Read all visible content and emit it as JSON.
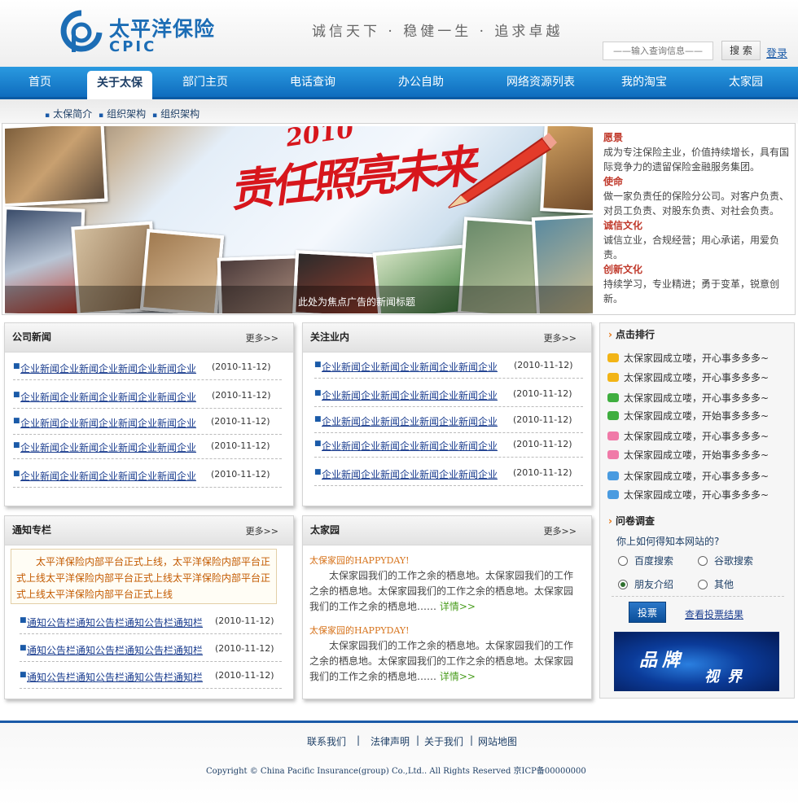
{
  "header": {
    "logo_cn": "太平洋保险",
    "logo_en": "CPIC",
    "slogan": "诚信天下 · 稳健一生 · 追求卓越",
    "search_placeholder": "——输入查询信息——",
    "search_button": "搜 索",
    "login": "登录"
  },
  "nav": {
    "items": [
      "首页",
      "关于太保",
      "部门主页",
      "电话查询",
      "办公自助",
      "网络资源列表",
      "我的淘宝",
      "太家园"
    ],
    "active": "关于太保"
  },
  "subnav": {
    "items": [
      "太保简介",
      "组织架构",
      "组织架构"
    ]
  },
  "banner": {
    "year": "2010",
    "headline": "责任照亮未来",
    "caption": "此处为焦点广告的新闻标题"
  },
  "culture": [
    {
      "title": "愿景",
      "text": "成为专注保险主业，价值持续增长，具有国际竞争力的遗留保险金融服务集团。"
    },
    {
      "title": "使命",
      "text": "做一家负责任的保险分公司。对客户负责、对员工负责、对股东负责、对社会负责。"
    },
    {
      "title": "诚信文化",
      "text": "诚信立业，合规经营；用心承诺，用爱负责。"
    },
    {
      "title": "创新文化",
      "text": "持续学习，专业精进；勇于变革，锐意创新。"
    }
  ],
  "company_news": {
    "title": "公司新闻",
    "more": "更多>>",
    "items": [
      {
        "title": "企业新闻企业新闻企业新闻企业新闻企业",
        "date": "(2010-11-12)"
      },
      {
        "title": "企业新闻企业新闻企业新闻企业新闻企业",
        "date": "(2010-11-12)"
      },
      {
        "title": "企业新闻企业新闻企业新闻企业新闻企业",
        "date": "(2010-11-12)"
      },
      {
        "title": "企业新闻企业新闻企业新闻企业新闻企业",
        "date": "(2010-11-12)"
      },
      {
        "title": "企业新闻企业新闻企业新闻企业新闻企业",
        "date": "(2010-11-12)"
      }
    ]
  },
  "industry_news": {
    "title": "关注业内",
    "more": "更多>>",
    "items": [
      {
        "title": "企业新闻企业新闻企业新闻企业新闻企业",
        "date": "(2010-11-12)"
      },
      {
        "title": "企业新闻企业新闻企业新闻企业新闻企业",
        "date": "(2010-11-12)"
      },
      {
        "title": "企业新闻企业新闻企业新闻企业新闻企业",
        "date": "(2010-11-12)"
      },
      {
        "title": "企业新闻企业新闻企业新闻企业新闻企业",
        "date": "(2010-11-12)"
      },
      {
        "title": "企业新闻企业新闻企业新闻企业新闻企业",
        "date": "(2010-11-12)"
      }
    ]
  },
  "notice": {
    "title": "通知专栏",
    "more": "更多>>",
    "highlight": "太平洋保险内部平台正式上线，太平洋保险内部平台正式上线太平洋保险内部平台正式上线太平洋保险内部平台正式上线太平洋保险内部平台正式上线",
    "items": [
      {
        "title": "通知公告栏通知公告栏通知公告栏通知栏",
        "date": "(2010-11-12)"
      },
      {
        "title": "通知公告栏通知公告栏通知公告栏通知栏",
        "date": "(2010-11-12)"
      },
      {
        "title": "通知公告栏通知公告栏通知公告栏通知栏",
        "date": "(2010-11-12)"
      }
    ]
  },
  "family": {
    "title": "太家园",
    "more": "更多>>",
    "posts": [
      {
        "title": "太保家园的HAPPYDAY!",
        "text": "太保家园我们的工作之余的栖息地。太保家园我们的工作之余的栖息地。太保家园我们的工作之余的栖息地。太保家园我们的工作之余的栖息地……",
        "link": "详情>>"
      },
      {
        "title": "太保家园的HAPPYDAY!",
        "text": "太保家园我们的工作之余的栖息地。太保家园我们的工作之余的栖息地。太保家园我们的工作之余的栖息地。太保家园我们的工作之余的栖息地……",
        "link": "详情>>"
      }
    ]
  },
  "ranking": {
    "title": "点击排行",
    "items": [
      {
        "icon": "yellow-chat-icon",
        "color": "#f2b416",
        "text": "太保家园成立喽，开心事多多多~"
      },
      {
        "icon": "yellow-chat-icon",
        "color": "#f2b416",
        "text": "太保家园成立喽，开心事多多多~"
      },
      {
        "icon": "green-chat-icon",
        "color": "#3fae3f",
        "text": "太保家园成立喽，开心事多多多~"
      },
      {
        "icon": "green-chat-icon",
        "color": "#3fae3f",
        "text": "太保家园成立喽，开始事多多多~"
      },
      {
        "icon": "pink-chat-icon",
        "color": "#f07aa8",
        "text": "太保家园成立喽，开心事多多多~"
      },
      {
        "icon": "pink-chat-icon",
        "color": "#f07aa8",
        "text": "太保家园成立喽，开始事多多多~"
      },
      {
        "icon": "blue-chat-icon",
        "color": "#4a9be0",
        "text": "太保家园成立喽，开心事多多多~"
      },
      {
        "icon": "blue-chat-icon",
        "color": "#4a9be0",
        "text": "太保家园成立喽，开心事多多多~"
      }
    ]
  },
  "poll": {
    "title": "问卷调查",
    "question": "你上如何得知本网站的?",
    "options": [
      {
        "label": "百度搜索",
        "checked": false
      },
      {
        "label": "谷歌搜索",
        "checked": false
      },
      {
        "label": "朋友介绍",
        "checked": true
      },
      {
        "label": "其他",
        "checked": false
      }
    ],
    "vote_button": "投票",
    "view_results": "查看投票结果"
  },
  "brand_vision": {
    "line1": "品牌",
    "line2": "视界"
  },
  "footer": {
    "links": [
      "联系我们",
      "法律声明",
      "关于我们",
      "网站地图"
    ],
    "copyright": "Copyright © China Pacific Insurance(group) Co.,Ltd.. All Rights Reserved 京ICP备00000000"
  },
  "colors": {
    "brand_blue": "#1c6db5",
    "nav_blue": "#1a7fd0",
    "accent_orange": "#e87511",
    "culture_red": "#c0392b"
  }
}
